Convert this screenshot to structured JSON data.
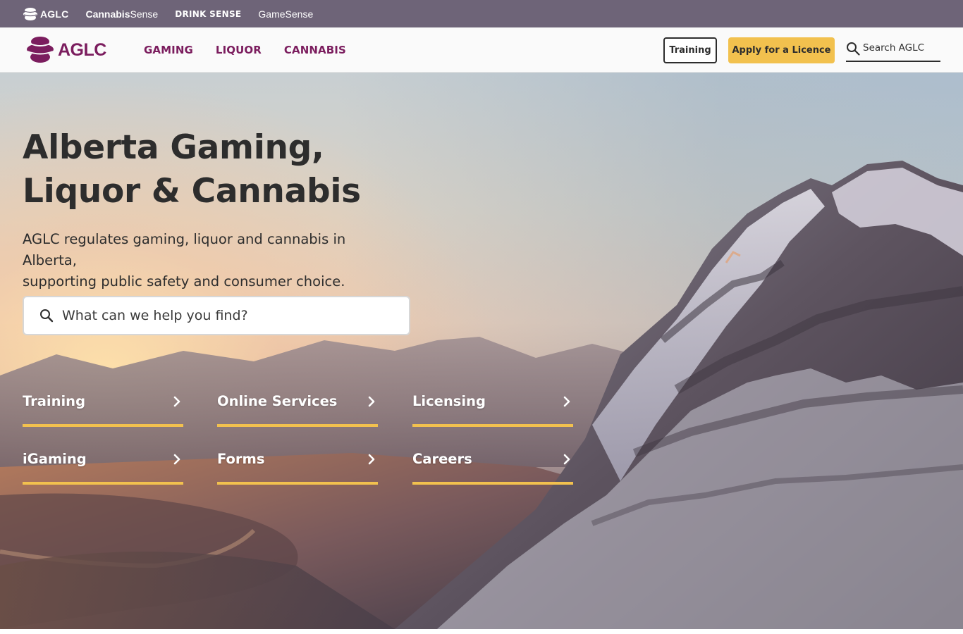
{
  "utility_bar": {
    "brands": [
      {
        "name": "AGLC"
      },
      {
        "prefix": "Cannabis",
        "suffix": "Sense"
      },
      {
        "name": "DRINK SENSE"
      },
      {
        "name": "GameSense"
      }
    ]
  },
  "header": {
    "logo_text": "AGLC",
    "nav": [
      "GAMING",
      "LIQUOR",
      "CANNABIS"
    ],
    "training_label": "Training",
    "apply_label": "Apply for a Licence",
    "search_placeholder": "Search AGLC"
  },
  "hero": {
    "title_line1": "Alberta Gaming,",
    "title_line2": "Liquor & Cannabis",
    "description_line1": "AGLC regulates gaming, liquor and cannabis in Alberta,",
    "description_line2": "supporting public safety and consumer choice.",
    "search_placeholder": "What can we help you find?",
    "quick_links": [
      "Training",
      "Online Services",
      "Licensing",
      "iGaming",
      "Forms",
      "Careers"
    ]
  },
  "colors": {
    "brand_purple": "#7b1d5e",
    "accent_yellow": "#f2c14e",
    "utility_bar": "#6e6478",
    "text_dark": "#2d2d2d"
  },
  "icons": [
    "aglc-logo-icon",
    "search-icon",
    "chevron-right-icon"
  ]
}
